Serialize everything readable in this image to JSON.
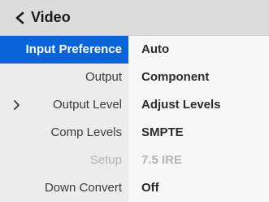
{
  "header": {
    "title": "Video",
    "back_icon": "chevron-left-icon"
  },
  "rows": [
    {
      "label": "Input Preference",
      "value": "Auto",
      "selected": true,
      "disabled": false
    },
    {
      "label": "Output",
      "value": "Component",
      "selected": false,
      "disabled": false
    },
    {
      "label": "Output Level",
      "value": "Adjust Levels",
      "selected": false,
      "disabled": false,
      "submenu_icon": "chevron-right-icon"
    },
    {
      "label": "Comp Levels",
      "value": "SMPTE",
      "selected": false,
      "disabled": false
    },
    {
      "label": "Setup",
      "value": "7.5 IRE",
      "selected": false,
      "disabled": true
    },
    {
      "label": "Down Convert",
      "value": "Off",
      "selected": false,
      "disabled": false
    }
  ],
  "colors": {
    "accent": "#0a64d8",
    "header_bg": "#dcdcdc",
    "disabled_text": "#b5b5b5"
  }
}
